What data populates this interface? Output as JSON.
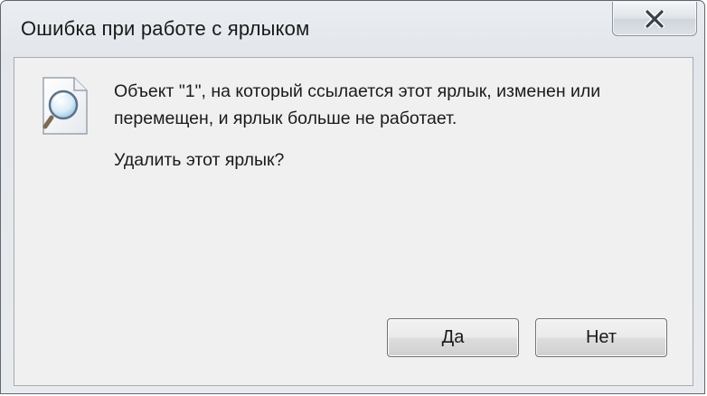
{
  "window": {
    "title": "Ошибка при работе с ярлыком"
  },
  "titlebar": {
    "close_icon": "close-icon"
  },
  "dialog": {
    "icon": "file-magnifier-icon",
    "message": "Объект \"1\", на который ссылается этот ярлык, изменен или перемещен, и ярлык больше не работает.",
    "question": "Удалить этот ярлык?",
    "buttons": {
      "yes_label": "Да",
      "no_label": "Нет"
    }
  },
  "colors": {
    "close_button_glyph": "#3a4048",
    "client_background": "#f0f0f0",
    "frame_border": "#5f6872"
  }
}
